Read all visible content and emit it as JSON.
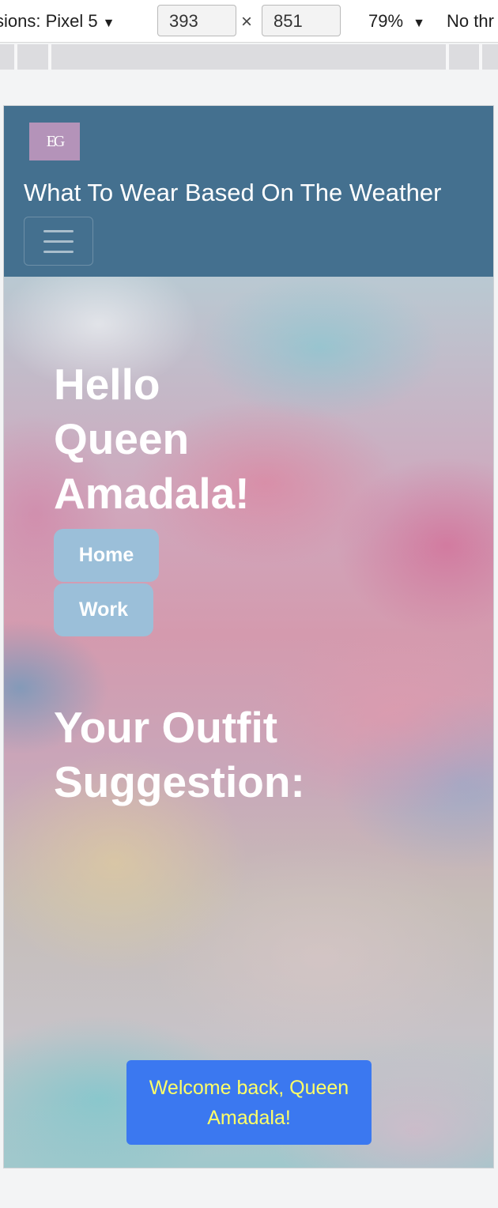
{
  "devtools": {
    "device_label": "sions: Pixel 5",
    "caret": "▼",
    "width": "393",
    "times": "×",
    "height": "851",
    "zoom": "79%",
    "throttle": "No thr"
  },
  "nav": {
    "logo_text": "EG",
    "brand": "What To Wear Based On The Weather"
  },
  "hero": {
    "greeting": "Hello Queen Amadala!",
    "buttons": {
      "home": "Home",
      "work": "Work"
    },
    "outfit_title": "Your Outfit Suggestion:"
  },
  "toast": {
    "message": "Welcome back, Queen Amadala!"
  },
  "colors": {
    "navbar": "#44708f",
    "logo_bg": "#b493b9",
    "soft_button": "#9bbfd9",
    "toast_bg": "#3b78f0",
    "toast_text": "#ffff66"
  }
}
